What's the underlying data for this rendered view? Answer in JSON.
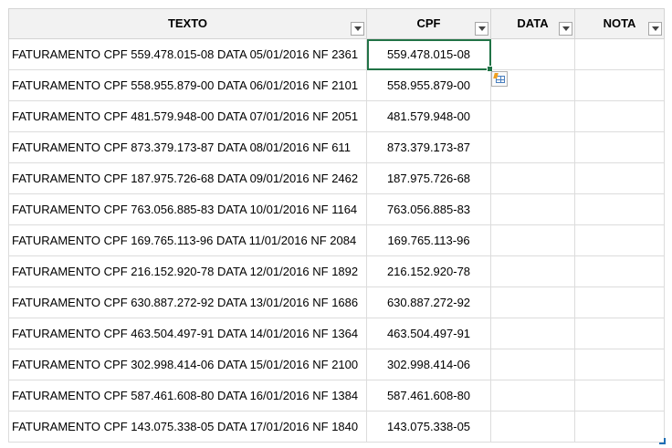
{
  "headers": {
    "texto": "TEXTO",
    "cpf": "CPF",
    "data": "DATA",
    "nota": "NOTA"
  },
  "rows": [
    {
      "texto": "FATURAMENTO CPF 559.478.015-08 DATA 05/01/2016 NF 2361",
      "cpf": "559.478.015-08",
      "data": "",
      "nota": ""
    },
    {
      "texto": "FATURAMENTO CPF 558.955.879-00 DATA 06/01/2016 NF 2101",
      "cpf": "558.955.879-00",
      "data": "",
      "nota": ""
    },
    {
      "texto": "FATURAMENTO CPF 481.579.948-00 DATA 07/01/2016 NF 2051",
      "cpf": "481.579.948-00",
      "data": "",
      "nota": ""
    },
    {
      "texto": "FATURAMENTO CPF 873.379.173-87 DATA 08/01/2016 NF 611",
      "cpf": "873.379.173-87",
      "data": "",
      "nota": ""
    },
    {
      "texto": "FATURAMENTO CPF 187.975.726-68 DATA 09/01/2016 NF 2462",
      "cpf": "187.975.726-68",
      "data": "",
      "nota": ""
    },
    {
      "texto": "FATURAMENTO CPF 763.056.885-83 DATA 10/01/2016 NF 1164",
      "cpf": "763.056.885-83",
      "data": "",
      "nota": ""
    },
    {
      "texto": "FATURAMENTO CPF 169.765.113-96 DATA 11/01/2016 NF 2084",
      "cpf": "169.765.113-96",
      "data": "",
      "nota": ""
    },
    {
      "texto": "FATURAMENTO CPF 216.152.920-78 DATA 12/01/2016 NF 1892",
      "cpf": "216.152.920-78",
      "data": "",
      "nota": ""
    },
    {
      "texto": "FATURAMENTO CPF 630.887.272-92 DATA 13/01/2016 NF 1686",
      "cpf": "630.887.272-92",
      "data": "",
      "nota": ""
    },
    {
      "texto": "FATURAMENTO CPF 463.504.497-91 DATA 14/01/2016 NF 1364",
      "cpf": "463.504.497-91",
      "data": "",
      "nota": ""
    },
    {
      "texto": "FATURAMENTO CPF 302.998.414-06 DATA 15/01/2016 NF 2100",
      "cpf": "302.998.414-06",
      "data": "",
      "nota": ""
    },
    {
      "texto": "FATURAMENTO CPF 587.461.608-80 DATA 16/01/2016 NF 1384",
      "cpf": "587.461.608-80",
      "data": "",
      "nota": ""
    },
    {
      "texto": "FATURAMENTO CPF 143.075.338-05 DATA 17/01/2016 NF 1840",
      "cpf": "143.075.338-05",
      "data": "",
      "nota": ""
    }
  ],
  "selected_cell": {
    "row": 0,
    "column": "cpf"
  },
  "icons": {
    "filter": "dropdown-arrow-icon",
    "flash_fill": "flash-fill-options-icon"
  },
  "colors": {
    "selection": "#217346",
    "header_bg": "#f2f2f2",
    "gridline": "#dcdcdc"
  }
}
